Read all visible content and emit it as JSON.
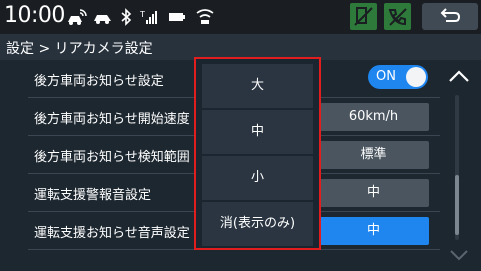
{
  "status": {
    "time": "10:00",
    "icons": [
      "connected-car-icon",
      "car-icon",
      "bluetooth-icon",
      "signal-icon",
      "battery-icon",
      "wifi-icon"
    ]
  },
  "header": {
    "back_icon": "return-arrow-icon"
  },
  "breadcrumb": "設定 > リアカメラ設定",
  "settings": [
    {
      "label": "後方車両お知らせ設定",
      "value": "ON",
      "kind": "toggle"
    },
    {
      "label": "後方車両お知らせ開始速度",
      "value": "60km/h",
      "kind": "button"
    },
    {
      "label": "後方車両お知らせ検知範囲",
      "value": "標準",
      "kind": "button"
    },
    {
      "label": "運転支援警報音設定",
      "value": "中",
      "kind": "button"
    },
    {
      "label": "運転支援お知らせ音声設定",
      "value": "中",
      "kind": "button",
      "active": true
    }
  ],
  "popup": {
    "options": [
      "大",
      "中",
      "小",
      "消(表示のみ)"
    ]
  },
  "colors": {
    "accent": "#1f86f0",
    "highlight": "#e21d1d",
    "phone_green": "#2e7a3a"
  }
}
